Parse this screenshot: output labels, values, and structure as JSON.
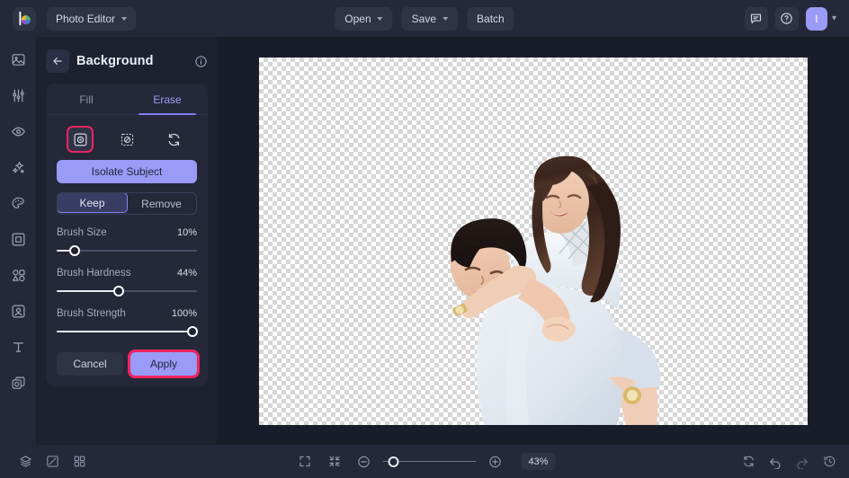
{
  "app": {
    "name": "Photo Editor",
    "logo_icon": "color-wheel-logo"
  },
  "topbar": {
    "app_menu_label": "Photo Editor",
    "open_label": "Open",
    "save_label": "Save",
    "batch_label": "Batch",
    "feedback_icon": "comment-icon",
    "help_icon": "question-circle-icon",
    "avatar_initial": "I",
    "avatar_color": "#9a9bf7",
    "avatar_caret_icon": "chevron-down-icon"
  },
  "sidebar": {
    "items": [
      {
        "icon": "image-icon",
        "name": "image"
      },
      {
        "icon": "sliders-icon",
        "name": "adjust"
      },
      {
        "icon": "eye-icon",
        "name": "retouch"
      },
      {
        "icon": "sparkles-icon",
        "name": "effects"
      },
      {
        "icon": "palette-icon",
        "name": "color"
      },
      {
        "icon": "frame-icon",
        "name": "frame"
      },
      {
        "icon": "shapes-icon",
        "name": "elements"
      },
      {
        "icon": "portrait-icon",
        "name": "portrait"
      },
      {
        "icon": "text-icon",
        "name": "text"
      },
      {
        "icon": "layers-overlay-icon",
        "name": "overlay"
      }
    ]
  },
  "panel": {
    "back_icon": "arrow-left-icon",
    "title": "Background",
    "info_icon": "info-circle-icon",
    "tabs": [
      {
        "label": "Fill",
        "active": false
      },
      {
        "label": "Erase",
        "active": true
      }
    ],
    "tools": [
      {
        "icon": "isolate-subject-icon",
        "name": "isolate-subject-tool",
        "selected": true
      },
      {
        "icon": "erase-brush-icon",
        "name": "erase-brush-tool",
        "selected": false
      },
      {
        "icon": "restore-icon",
        "name": "restore-tool",
        "selected": false
      }
    ],
    "isolate_subject_label": "Isolate Subject",
    "mode": {
      "keep_label": "Keep",
      "remove_label": "Remove",
      "active": "Keep"
    },
    "sliders": [
      {
        "label": "Brush Size",
        "value_text": "10%",
        "value": 10
      },
      {
        "label": "Brush Hardness",
        "value_text": "44%",
        "value": 44
      },
      {
        "label": "Brush Strength",
        "value_text": "100%",
        "value": 100
      }
    ],
    "cancel_label": "Cancel",
    "apply_label": "Apply",
    "accent_color": "#9a9bf7",
    "highlight_color": "#f0245f"
  },
  "canvas": {
    "transparent_checkerboard": true,
    "subject_description": "couple-piggyback-cutout"
  },
  "bottombar": {
    "left_tools": [
      {
        "icon": "layers-icon",
        "name": "layers"
      },
      {
        "icon": "compare-icon",
        "name": "compare"
      },
      {
        "icon": "grid-icon",
        "name": "grid"
      }
    ],
    "fit_icon": "fit-screen-icon",
    "actual-size_icon": "collapse-icon",
    "zoom_out_icon": "minus-circle-icon",
    "zoom_in_icon": "plus-circle-icon",
    "zoom_value": "43%",
    "zoom_slider_percent": 12,
    "right_tools": [
      {
        "icon": "reset-icon",
        "name": "reset",
        "dim": false
      },
      {
        "icon": "undo-icon",
        "name": "undo",
        "dim": false
      },
      {
        "icon": "redo-icon",
        "name": "redo",
        "dim": true
      },
      {
        "icon": "history-icon",
        "name": "history",
        "dim": false
      }
    ]
  }
}
